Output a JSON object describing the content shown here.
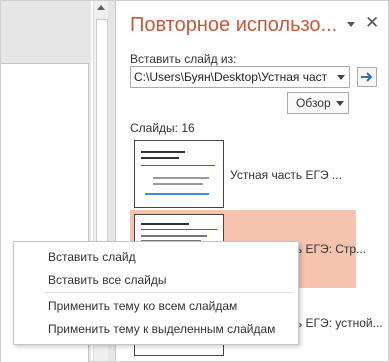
{
  "pane": {
    "title": "Повторное использо...",
    "insert_from_label": "Вставить слайд из:",
    "path_value": "C:\\Users\\Буян\\Desktop\\Устная часть",
    "browse_label": "Обзор",
    "slides_count": "Слайды: 16"
  },
  "slides": [
    {
      "label": "Устная часть ЕГЭ ..."
    },
    {
      "label": "Устная часть ЕГЭ: Стр..."
    },
    {
      "label": "Устная часть ЕГЭ: устной..."
    }
  ],
  "context_menu": {
    "items": [
      "Вставить слайд",
      "Вставить все слайды",
      "Применить тему ко всем слайдам",
      "Применить тему к выделенным слайдам"
    ]
  },
  "colors": {
    "title": "#c55a3a",
    "selected_row": "#f5c3ae",
    "go_arrow": "#2e75b6"
  },
  "icons": {
    "pane_options": "chevron-down-icon",
    "pane_close": "close-icon",
    "go": "arrow-right-icon",
    "combo": "chevron-down-icon"
  }
}
